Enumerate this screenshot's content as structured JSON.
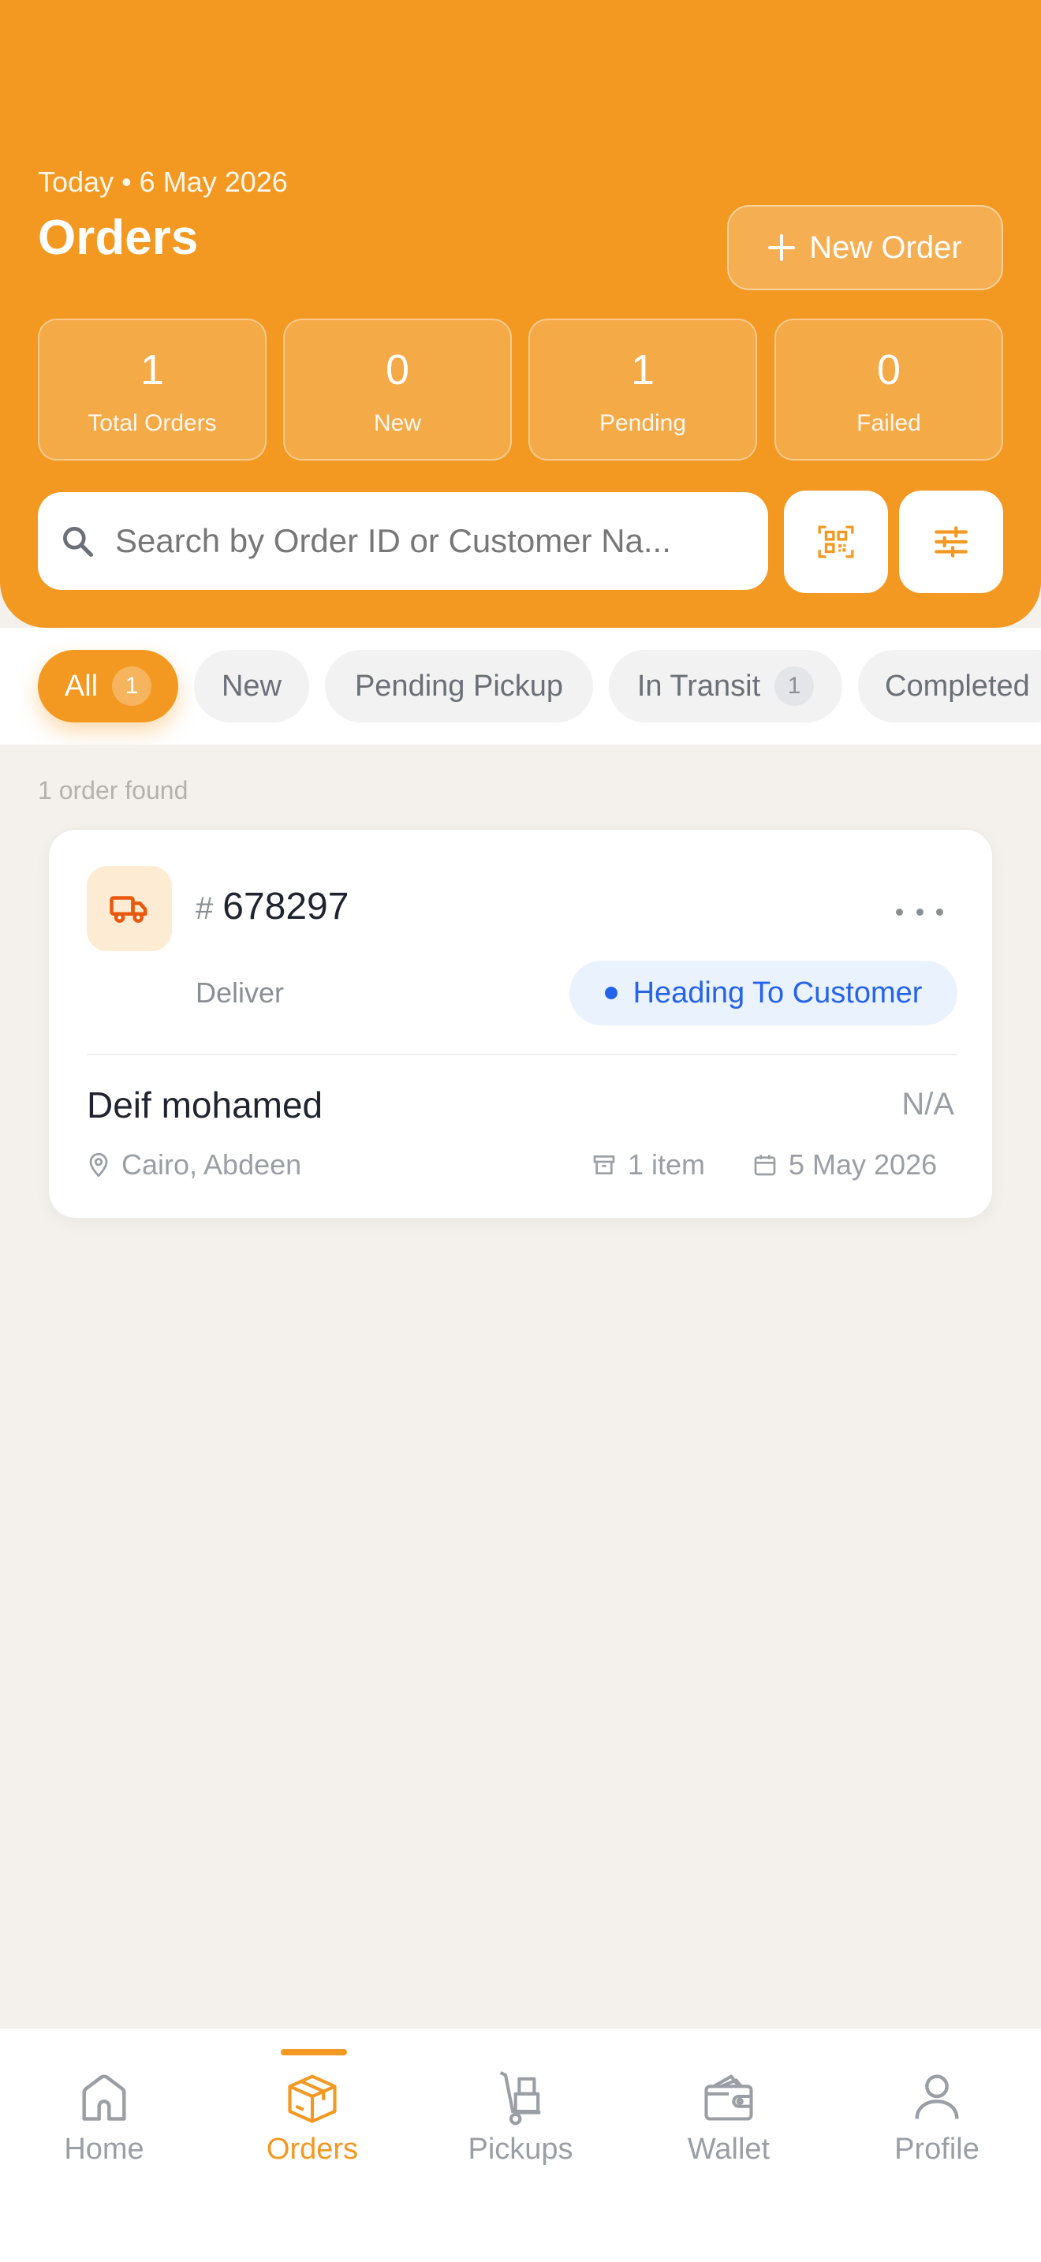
{
  "header": {
    "date_line": "Today • 6 May 2026",
    "title": "Orders",
    "new_order_label": "New Order"
  },
  "stats": [
    {
      "value": "1",
      "label": "Total Orders"
    },
    {
      "value": "0",
      "label": "New"
    },
    {
      "value": "1",
      "label": "Pending"
    },
    {
      "value": "0",
      "label": "Failed"
    }
  ],
  "search": {
    "placeholder": "Search by Order ID or Customer Na...",
    "value": ""
  },
  "tabs": [
    {
      "label": "All",
      "count": "1",
      "active": true
    },
    {
      "label": "New"
    },
    {
      "label": "Pending Pickup"
    },
    {
      "label": "In Transit",
      "count": "1"
    },
    {
      "label": "Completed"
    }
  ],
  "results": {
    "found_text": "1 order found"
  },
  "order": {
    "hash": "#",
    "id": "678297",
    "type": "Deliver",
    "status": "Heading To Customer",
    "customer": "Deif mohamed",
    "amount": "N/A",
    "location": "Cairo, Abdeen",
    "items": "1 item",
    "date": "5 May 2026"
  },
  "nav": [
    {
      "label": "Home",
      "icon": "home-icon"
    },
    {
      "label": "Orders",
      "icon": "box-icon",
      "active": true
    },
    {
      "label": "Pickups",
      "icon": "hand-truck-icon"
    },
    {
      "label": "Wallet",
      "icon": "wallet-icon"
    },
    {
      "label": "Profile",
      "icon": "user-icon"
    }
  ],
  "colors": {
    "accent": "#F39820",
    "status_blue": "#2563EB",
    "background": "#F4F0EB"
  }
}
